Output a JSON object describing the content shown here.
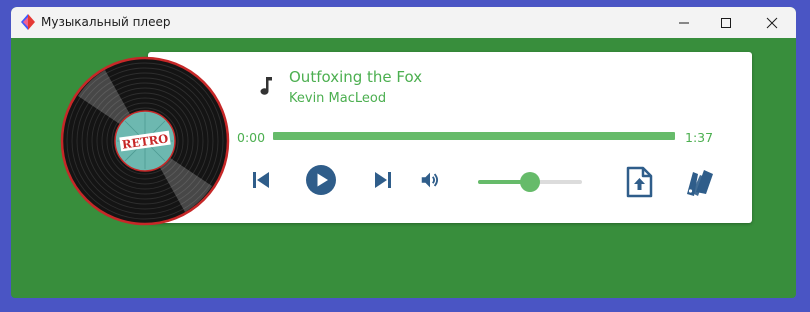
{
  "window": {
    "title": "Музыкальный плеер",
    "icon": "app-logo-icon",
    "buttons": [
      "minimize-icon",
      "maximize-icon",
      "close-icon"
    ]
  },
  "player": {
    "track_title": "Outfoxing the Fox",
    "artist": "Kevin MacLeod",
    "current_time": "0:00",
    "total_time": "1:37",
    "progress_fraction": 1.0,
    "volume_fraction": 0.5,
    "record_label": "RETRO",
    "icons": {
      "note": "music-note-icon",
      "prev": "skip-previous-icon",
      "play": "play-icon",
      "next": "skip-next-icon",
      "volume": "volume-icon",
      "upload": "file-upload-icon",
      "theme": "palette-swatch-icon"
    }
  },
  "colors": {
    "accent": "#4caf50",
    "accent_light": "#66bb6a",
    "control_blue": "#2f5d8a",
    "background_green": "#388e3c",
    "desktop_blue": "#4a55c4",
    "vinyl_rim": "#c62828"
  }
}
